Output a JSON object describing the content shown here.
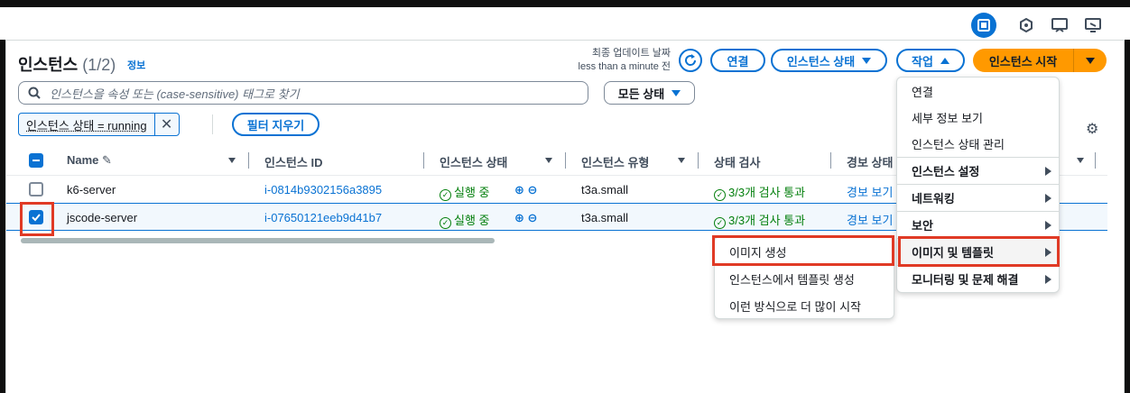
{
  "title": {
    "main": "인스턴스",
    "count": "(1/2)",
    "info": "정보"
  },
  "last_update": {
    "label": "최종 업데이트 날짜",
    "value": "less than a minute 전"
  },
  "toolbar": {
    "connect": "연결",
    "instance_state": "인스턴스 상태",
    "actions": "작업",
    "launch": "인스턴스 시작"
  },
  "search": {
    "placeholder": "인스턴스을 속성 또는 (case-sensitive) 태그로 찾기"
  },
  "filter": {
    "state_select": "모든 상태",
    "token": "인스턴스 상태 = running",
    "clear": "필터 지우기"
  },
  "columns": [
    "Name",
    "인스턴스 ID",
    "인스턴스 상태",
    "인스턴스 유형",
    "상태 검사",
    "경보 상태"
  ],
  "rows": [
    {
      "name": "k6-server",
      "id": "i-0814b9302156a3895",
      "state": "실행 중",
      "type": "t3a.small",
      "check": "3/3개 검사 통과",
      "alarm": "경보 보기",
      "selected": false
    },
    {
      "name": "jscode-server",
      "id": "i-07650121eeb9d41b7",
      "state": "실행 중",
      "type": "t3a.small",
      "check": "3/3개 검사 통과",
      "alarm": "경보 보기",
      "selected": true
    }
  ],
  "actions_menu": {
    "items": [
      "연결",
      "세부 정보 보기",
      "인스턴스 상태 관리"
    ],
    "groups": [
      "인스턴스 설정",
      "네트워킹",
      "보안",
      "이미지 및 템플릿",
      "모니터링 및 문제 해결"
    ]
  },
  "submenu": {
    "items": [
      "이미지 생성",
      "인스턴스에서 템플릿 생성",
      "이런 방식으로 더 많이 시작"
    ]
  },
  "colors": {
    "accent": "#0972d3",
    "primary": "#ff9900",
    "success": "#037f0c",
    "highlight": "#e03a25"
  }
}
